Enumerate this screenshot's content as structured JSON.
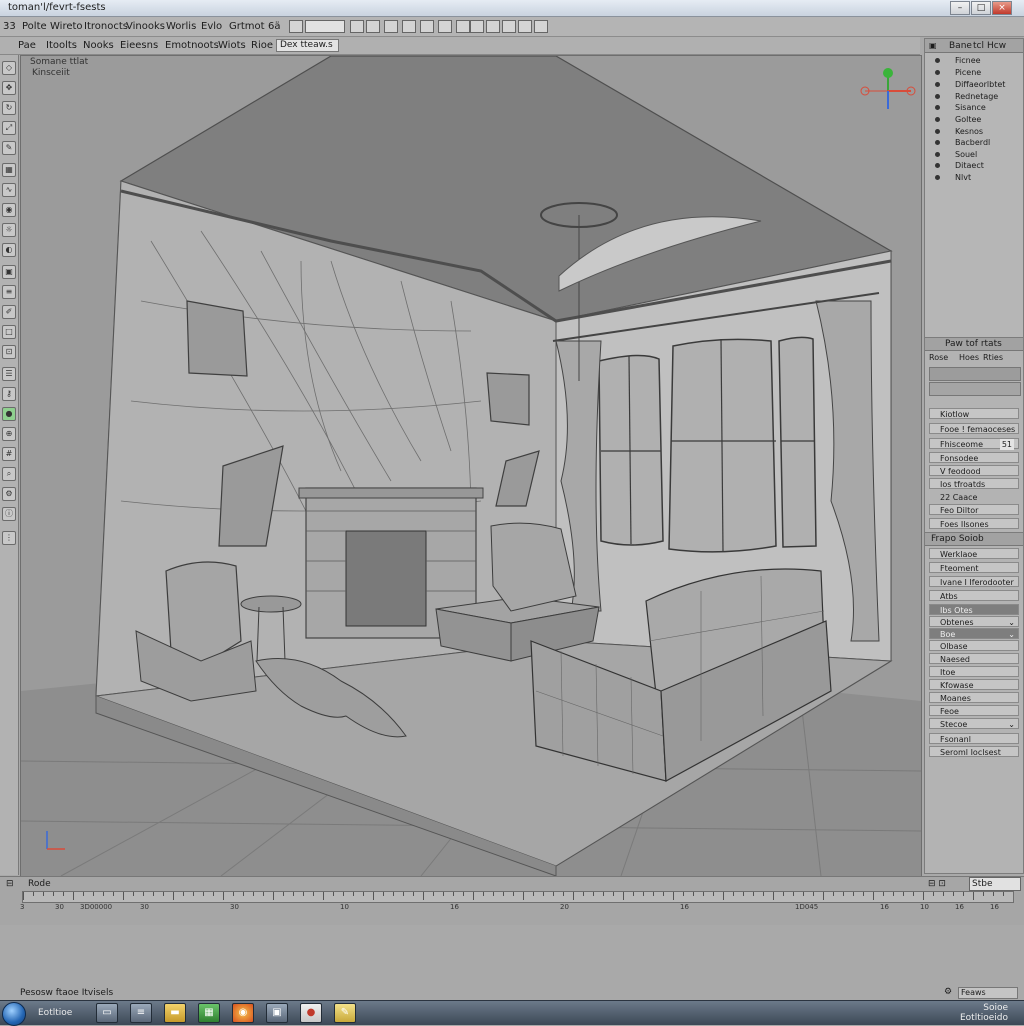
{
  "window": {
    "title": "toman'l/fevrt-fsests"
  },
  "menubar": {
    "prefix": "33",
    "items": [
      "Polte",
      "Wireto",
      "Itronocts",
      "Vinooks",
      "Worlis",
      "Evlo",
      "Grtmot",
      "6ä"
    ]
  },
  "toolbar": {
    "items": [
      "Pae",
      "Itoolts",
      "Nooks",
      "Eieesns",
      "Emotnoots",
      "Wiots",
      "Rioe"
    ],
    "dropdown": "Dex tteaw.s"
  },
  "viewport": {
    "label_line1": "Somane ttlat",
    "label_line2": "Kinsceiit"
  },
  "outliner": {
    "header": [
      "Bane",
      "tcl",
      "Hcw"
    ],
    "items": [
      "Ficnee",
      "Picene",
      "Diffaeorlbtet",
      "Rednetage",
      "Sisance",
      "Goltee",
      "Kesnos",
      "Bacberdl",
      "Souel",
      "Ditaect",
      "Nlvt"
    ]
  },
  "properties": {
    "title": "Paw tof rtats",
    "tabs": [
      "Rose",
      "Hoes",
      "Rties"
    ],
    "rows": [
      {
        "label": "Kiotlow",
        "value": ""
      },
      {
        "label": "Fooe ! femaoceses",
        "value": ""
      },
      {
        "label": "Fhisceome",
        "value": "51"
      },
      {
        "label": "Fonsodee",
        "value": ""
      },
      {
        "label": "V feodood",
        "value": ""
      },
      {
        "label": "Ios tfroatds",
        "value": ""
      },
      {
        "label": "22 Caace",
        "value": ""
      },
      {
        "label": "Feo Diltor",
        "value": ""
      },
      {
        "label": "Foes Ilsones",
        "value": ""
      }
    ]
  },
  "scene_panel": {
    "title": "Frapo Soiob",
    "rows": [
      {
        "label": "Werklaoe",
        "dark": false
      },
      {
        "label": "Fteoment",
        "dark": false
      },
      {
        "label": "Ivane I Iferodooter",
        "dark": false
      },
      {
        "label": "Atbs",
        "dark": false
      },
      {
        "label": "Ibs Otes",
        "dark": true
      },
      {
        "label": "Obtenes",
        "dark": false
      },
      {
        "label": "Boe",
        "dark": true
      },
      {
        "label": "Olbase",
        "dark": false
      },
      {
        "label": "Naesed",
        "dark": false
      },
      {
        "label": "Itoe",
        "dark": false
      },
      {
        "label": "Kfowase",
        "dark": false
      },
      {
        "label": "Moanes",
        "dark": false
      },
      {
        "label": "Feoe",
        "dark": false
      },
      {
        "label": "Stecoe",
        "dark": false
      },
      {
        "label": "Fsonanl",
        "dark": false
      },
      {
        "label": "Seroml Ioclsest",
        "dark": false
      }
    ]
  },
  "timeline": {
    "label": "Rode",
    "right_label": "Stbe",
    "marks": [
      "3",
      "30",
      "30",
      "3D00000",
      "30",
      "10",
      "16",
      "20",
      "16",
      "1D045",
      "16",
      "10",
      "16",
      "16"
    ]
  },
  "statusbar": {
    "text": "Pesosw ftaoe Itvisels",
    "field": "Feaws"
  },
  "taskbar": {
    "label": "Eotltioe",
    "clock_line1": "Soioe",
    "clock_line2": "Eotltioeido"
  }
}
